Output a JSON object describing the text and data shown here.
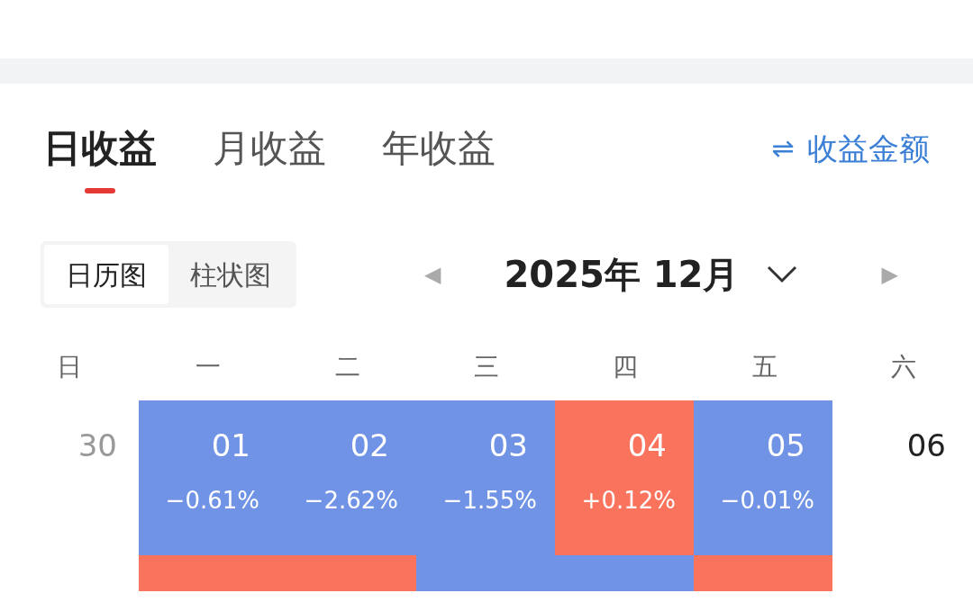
{
  "tabs": [
    {
      "label": "日收益",
      "selected": true
    },
    {
      "label": "月收益",
      "selected": false
    },
    {
      "label": "年收益",
      "selected": false
    }
  ],
  "switch_link": {
    "icon": "⇌",
    "label": "收益金额"
  },
  "view_toggle": [
    {
      "label": "日历图",
      "selected": true
    },
    {
      "label": "柱状图",
      "selected": false
    }
  ],
  "month_nav": {
    "prev": "◀",
    "title": "2025年 12月",
    "next": "▶"
  },
  "weekdays": [
    "日",
    "一",
    "二",
    "三",
    "四",
    "五",
    "六"
  ],
  "weeks": [
    [
      {
        "day": "30",
        "kind": "plain"
      },
      {
        "day": "01",
        "change": "−0.61%",
        "kind": "colored",
        "color": "#7093e6"
      },
      {
        "day": "02",
        "change": "−2.62%",
        "kind": "colored",
        "color": "#7093e6"
      },
      {
        "day": "03",
        "change": "−1.55%",
        "kind": "colored",
        "color": "#7093e6"
      },
      {
        "day": "04",
        "change": "+0.12%",
        "kind": "colored",
        "color": "#fa735c"
      },
      {
        "day": "05",
        "change": "−0.01%",
        "kind": "colored",
        "color": "#7093e6"
      },
      {
        "day": "06",
        "kind": "plain"
      }
    ],
    [
      {
        "kind": "plain"
      },
      {
        "kind": "colored",
        "color": "#fa735c"
      },
      {
        "kind": "colored",
        "color": "#fa735c"
      },
      {
        "kind": "colored",
        "color": "#7093e6"
      },
      {
        "kind": "colored",
        "color": "#7093e6"
      },
      {
        "kind": "colored",
        "color": "#fa735c"
      },
      {
        "kind": "plain"
      }
    ]
  ]
}
